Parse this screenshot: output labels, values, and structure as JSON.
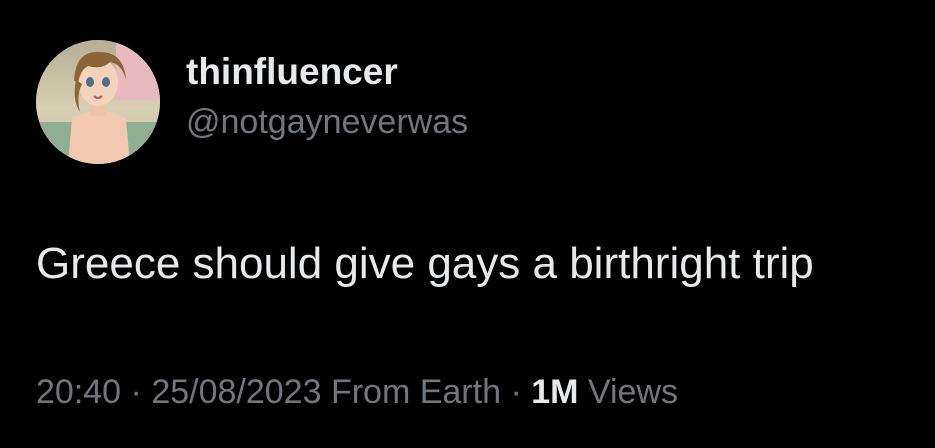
{
  "user": {
    "display_name": "thinfluencer",
    "handle": "@notgayneverwas",
    "avatar_icon": "anime-character-avatar"
  },
  "tweet": {
    "text": "Greece should give gays a birthright trip"
  },
  "meta": {
    "time": "20:40",
    "separator": "·",
    "date": "25/08/2023",
    "source": "From Earth",
    "views_count": "1M",
    "views_label": "Views"
  },
  "colors": {
    "background": "#000000",
    "primary_text": "#e7e9ea",
    "secondary_text": "#71767b"
  }
}
